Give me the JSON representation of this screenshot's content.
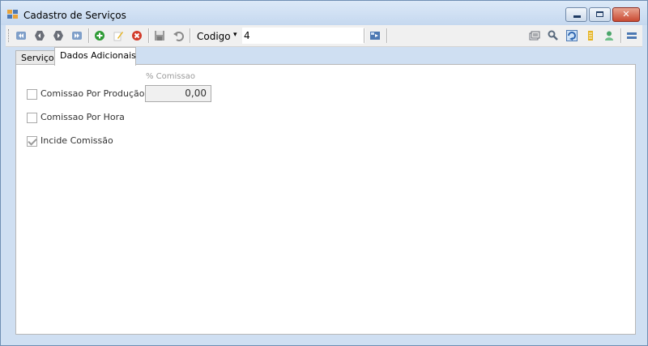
{
  "window": {
    "title": "Cadastro de Serviços",
    "close_glyph": "✕"
  },
  "toolbar": {
    "icons": [
      "first-record-icon",
      "previous-record-icon",
      "next-record-icon",
      "last-record-icon",
      "add-icon",
      "edit-icon",
      "cancel-icon",
      "save-icon",
      "undo-icon",
      "jump-icon",
      "list-icon",
      "search-icon",
      "refresh-icon",
      "report-icon",
      "user-icon",
      "menu-icon"
    ],
    "codigo_label": "Codigo",
    "codigo_caret": "▾",
    "codigo_value": "4"
  },
  "tabs": [
    {
      "label": "Serviço"
    },
    {
      "label": "Dados Adicionais",
      "active": true
    }
  ],
  "form": {
    "comissao_producao_label": "Comissao Por Produção",
    "comissao_hora_label": "Comissao Por Hora",
    "incide_comissao_label": "Incide Comissão",
    "percent_label": "% Comissao",
    "percent_value": "0,00",
    "comissao_producao_checked": false,
    "comissao_hora_checked": false,
    "incide_comissao_checked": true
  },
  "colors": {
    "accent_green": "#2e9b35",
    "cancel_red": "#d23b2a",
    "icon_blue": "#4d79b3"
  }
}
